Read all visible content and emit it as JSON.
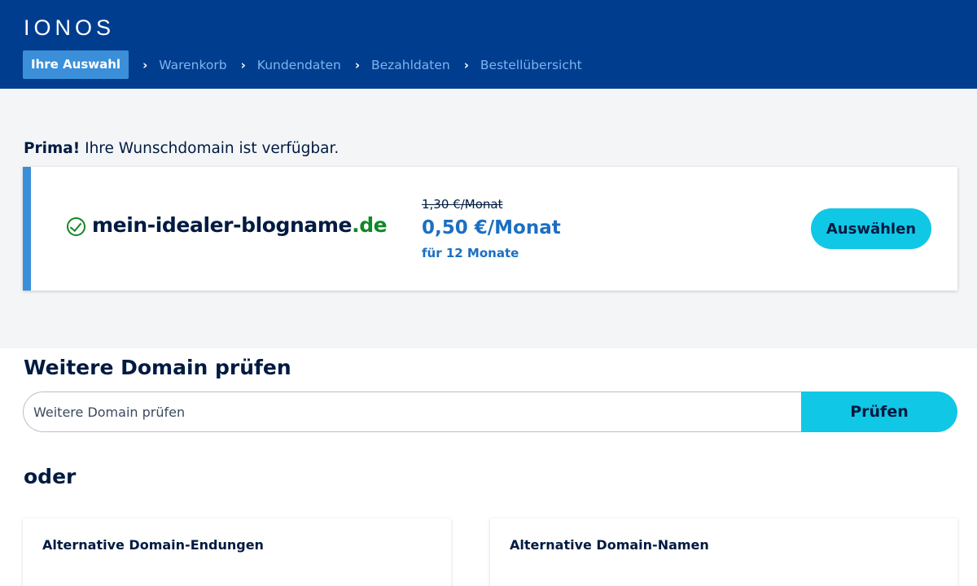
{
  "header": {
    "logo": "IONOS",
    "steps": {
      "active": "Ihre Auswahl",
      "s1": "Warenkorb",
      "s2": "Kundendaten",
      "s3": "Bezahldaten",
      "s4": "Bestellübersicht"
    },
    "colors": {
      "header_bg": "#003d8f",
      "active_step_bg": "#3a8fd8"
    }
  },
  "availability": {
    "prefix": "Prima!",
    "message": " Ihre Wunschdomain ist verfügbar."
  },
  "domain": {
    "name": "mein-idealer-blogname",
    "tld": ".de",
    "old_price": "1,30 €/Monat",
    "price": "0,50 €/Monat",
    "period": "für 12 Monate",
    "select_label": "Auswählen",
    "status_icon": "check-circle-icon"
  },
  "search": {
    "title": "Weitere Domain prüfen",
    "placeholder": "Weitere Domain prüfen",
    "button_label": "Prüfen"
  },
  "alternatives": {
    "separator": "oder",
    "endings_title": "Alternative Domain-Endungen",
    "names_title": "Alternative Domain-Namen"
  },
  "colors": {
    "accent": "#11c7e6",
    "price_blue": "#1b6fc2",
    "success_green": "#118827",
    "text_dark": "#001b41",
    "background_gray": "#f4f5f7"
  }
}
